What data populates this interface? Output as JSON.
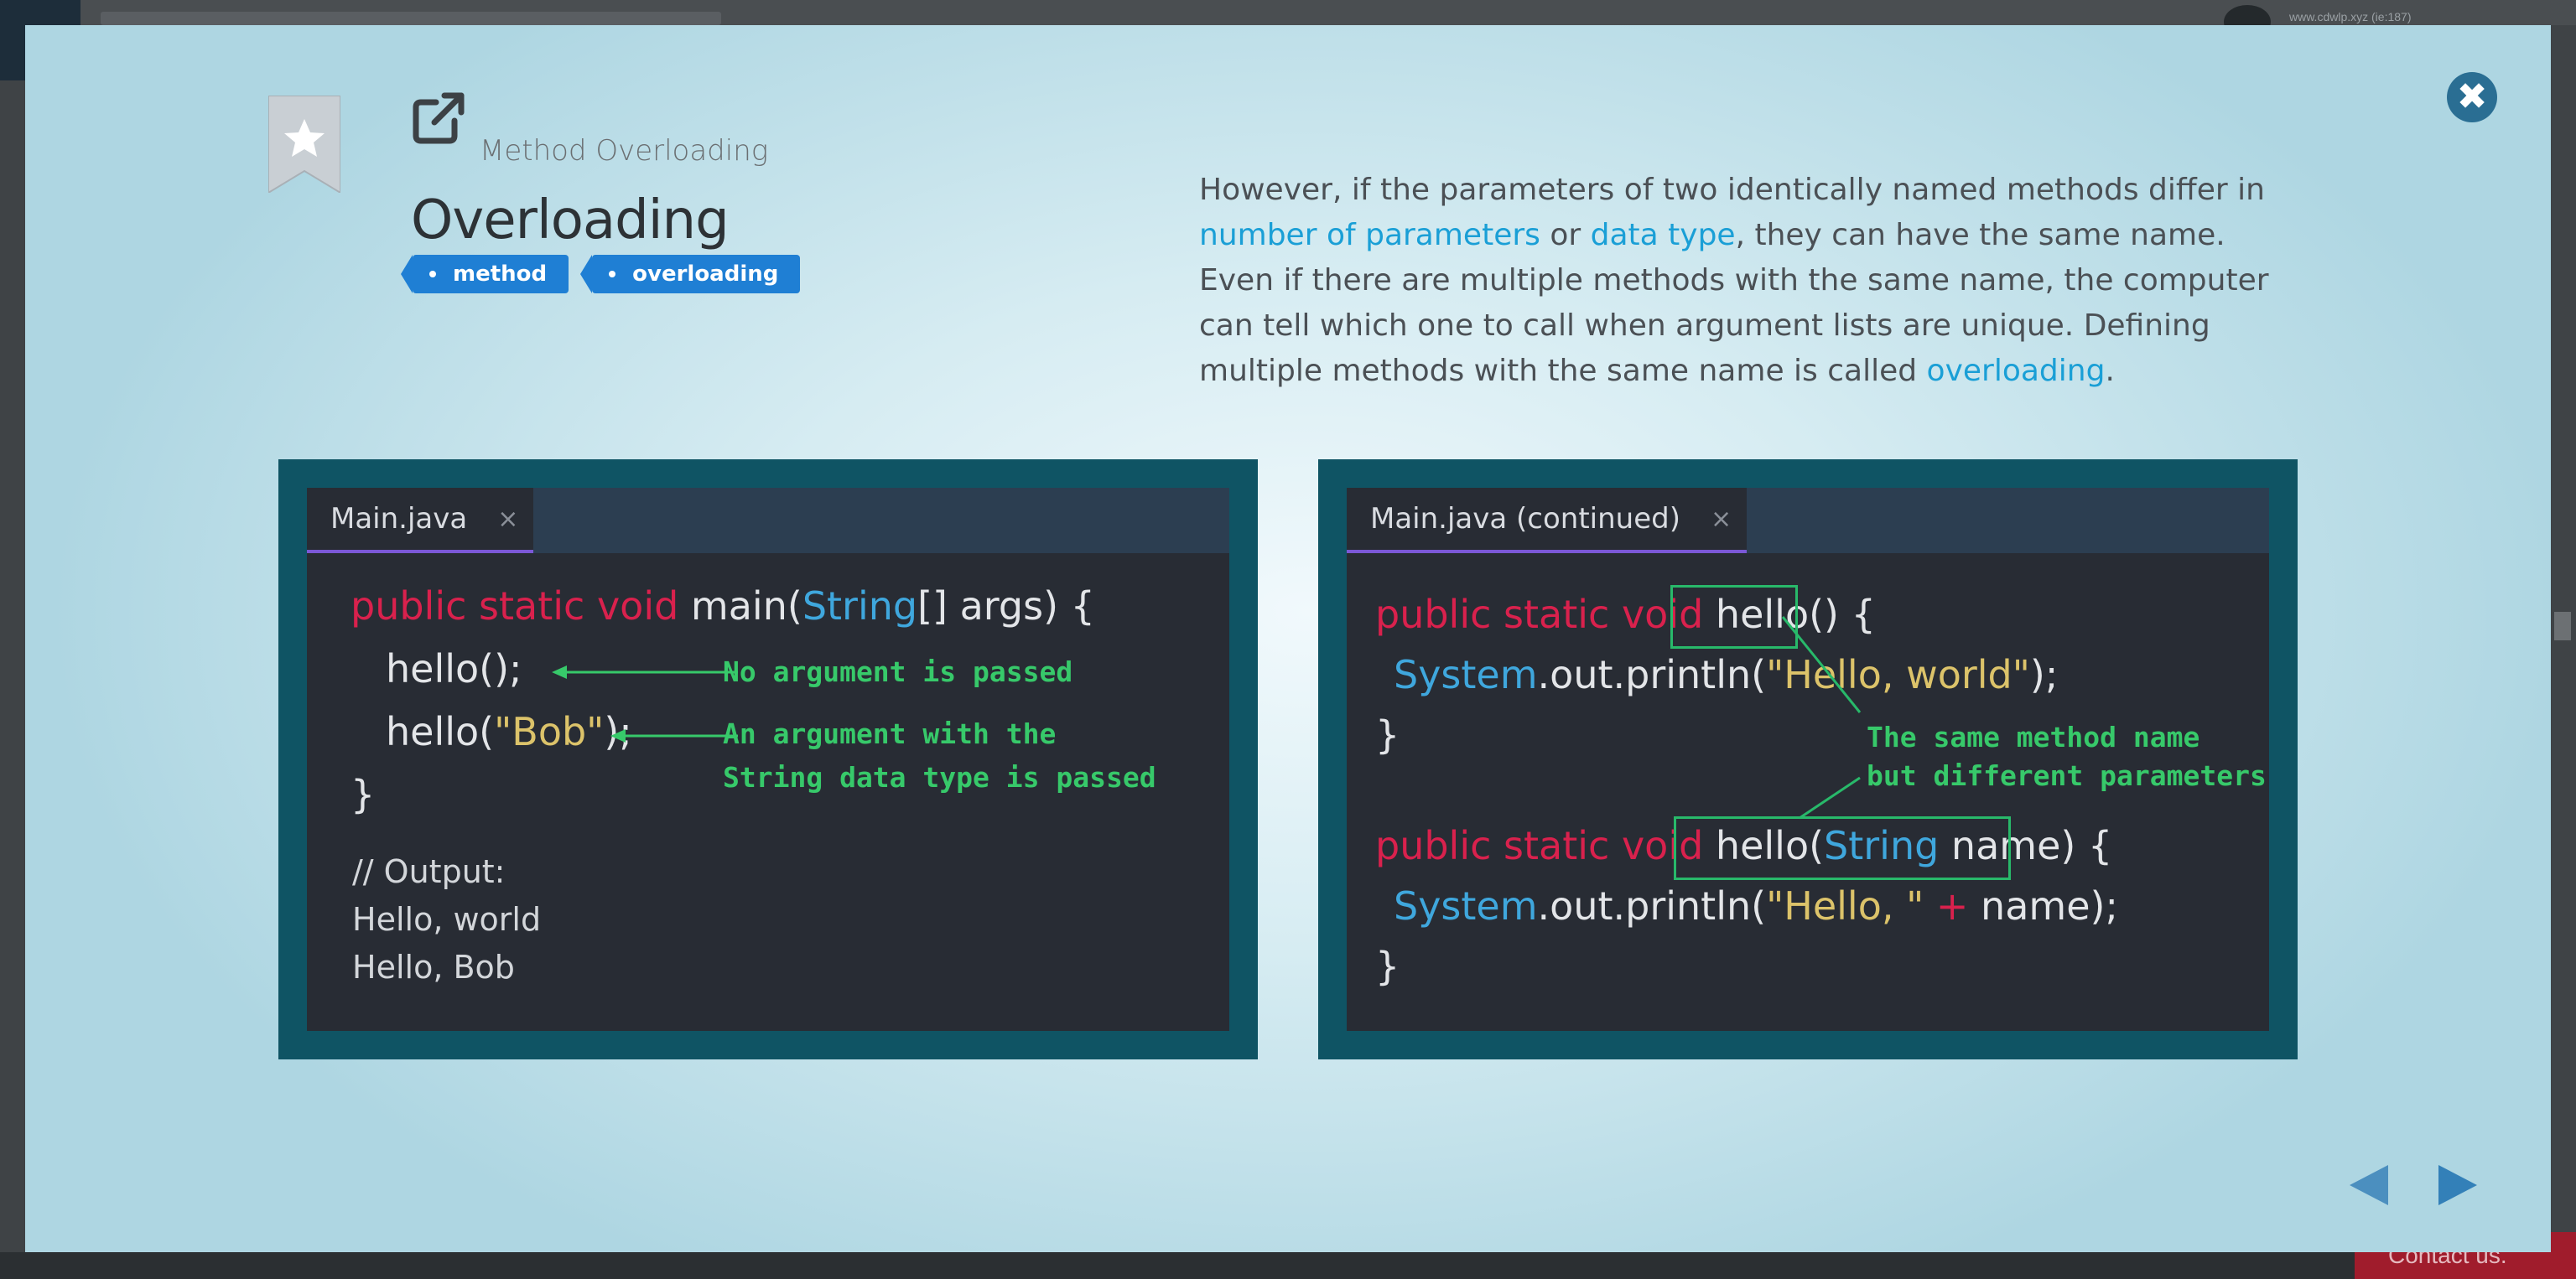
{
  "background": {
    "top_right_text": "www.cdwlp.xyz (ie:187)",
    "contact_label": "Contact us."
  },
  "header": {
    "subtitle": "Method Overloading",
    "title": "Overloading",
    "tags": [
      "method",
      "overloading"
    ]
  },
  "description": {
    "part1": "However, if the parameters of two identically named methods differ in ",
    "link1": "number of parameters",
    "part2": " or ",
    "link2": "data type",
    "part3": ", they can have the same name. Even if there are multiple methods with the same name, the computer can tell which one to call when argument lists are unique. Defining multiple methods with the same name is called ",
    "link3": "overloading",
    "part4": "."
  },
  "left_panel": {
    "tab_label": "Main.java",
    "tab_close": "×",
    "line1": {
      "kw": "public static void",
      "rest1": " main(",
      "type": "String",
      "rest2": "[] args) {"
    },
    "line2": "hello();",
    "line3": {
      "pre": "hello(",
      "str": "\"Bob\"",
      "post": ");"
    },
    "line4": "}",
    "annotation1": "No argument is passed",
    "annotation2_line1": "An argument with the",
    "annotation2_line2": "String data type is passed",
    "output_lines": [
      "// Output:",
      "Hello, world",
      "Hello, Bob"
    ]
  },
  "right_panel": {
    "tab_label": "Main.java (continued)",
    "tab_close": "×",
    "m1_kw": "public static void",
    "m1_sig": "hello()",
    "m1_brace": " {",
    "m1_body": {
      "type": "System",
      "mid": ".out.println(",
      "str": "\"Hello, world\"",
      "end": ");"
    },
    "m1_close": "}",
    "m2_kw": "public static void",
    "m2_sig": {
      "pre": "hello(",
      "type": "String",
      "post": " name)"
    },
    "m2_brace": " {",
    "m2_body": {
      "type": "System",
      "mid": ".out.println(",
      "str": "\"Hello, \"",
      "plus": " + ",
      "end": "name);"
    },
    "m2_close": "}",
    "annotation_line1": "The same method name",
    "annotation_line2": "but different parameters"
  },
  "icons": {
    "close": "close-icon",
    "bookmark": "bookmark-star-icon",
    "external": "external-link-icon",
    "prev": "arrow-left-icon",
    "next": "arrow-right-icon"
  },
  "colors": {
    "accent": "#1a9fd6",
    "tag": "#1f7fd4",
    "keyword": "#d9214d",
    "type": "#3fa7dd",
    "string": "#dcc36a",
    "annotation": "#37c96a",
    "panel": "#0f5464"
  }
}
